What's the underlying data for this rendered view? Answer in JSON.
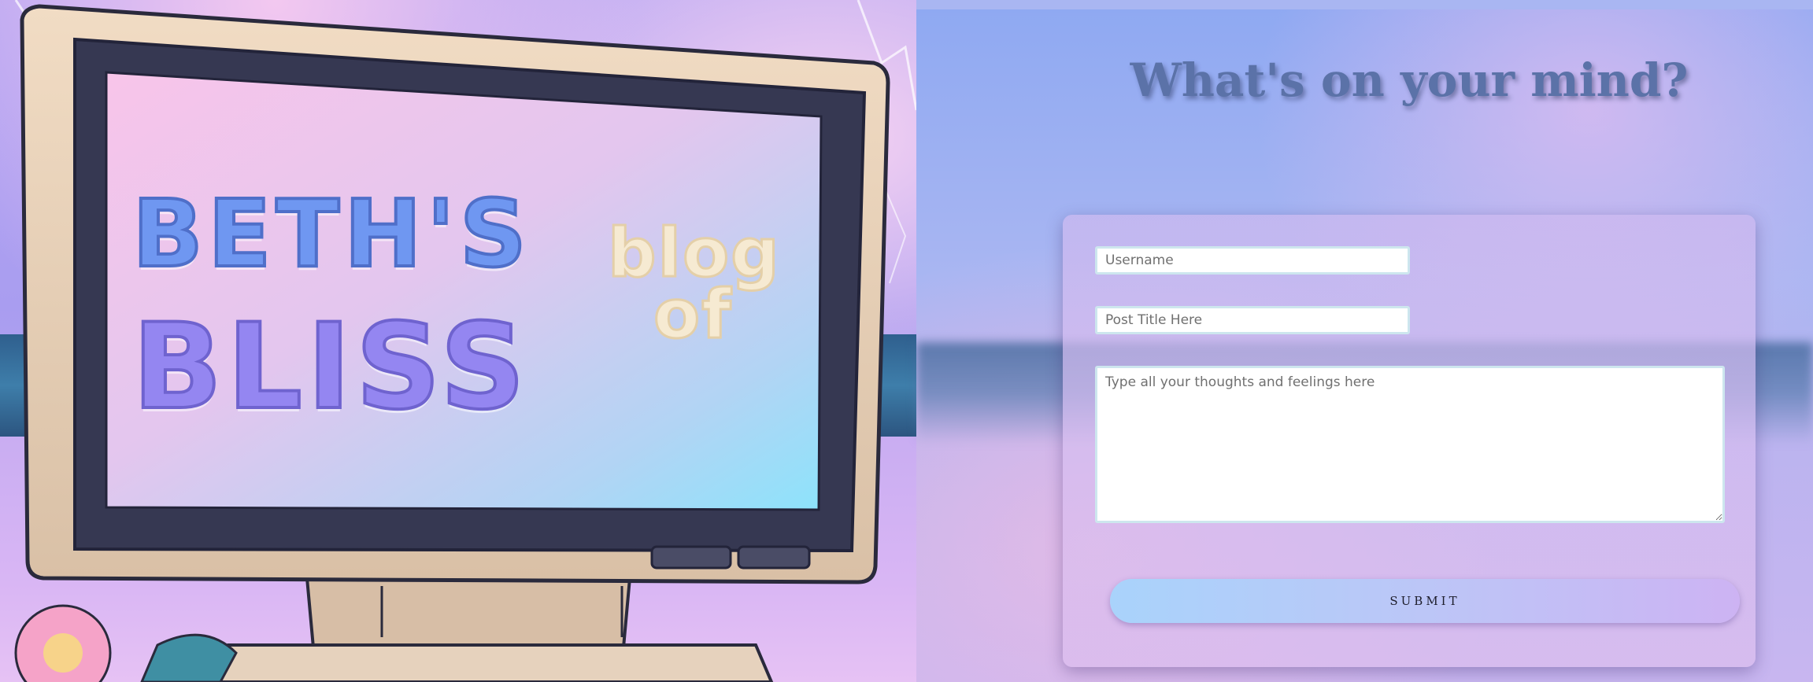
{
  "hero": {
    "logo_line1": "BETH'S",
    "logo_line2": "BLISS",
    "logo_word_blog": "blog",
    "logo_word_of": "of"
  },
  "form": {
    "heading": "What's on your mind?",
    "username_placeholder": "Username",
    "title_placeholder": "Post Title Here",
    "thoughts_placeholder": "Type all your thoughts and feelings here",
    "submit_label": "SUBMIT"
  },
  "colors": {
    "heading": "#5b72a8",
    "submit_gradient_start": "#a9d3fb",
    "submit_gradient_end": "#cdb3f3",
    "logo_blue": "#6f97f1",
    "logo_purple": "#9486f1",
    "logo_cream": "#f6ead2"
  }
}
